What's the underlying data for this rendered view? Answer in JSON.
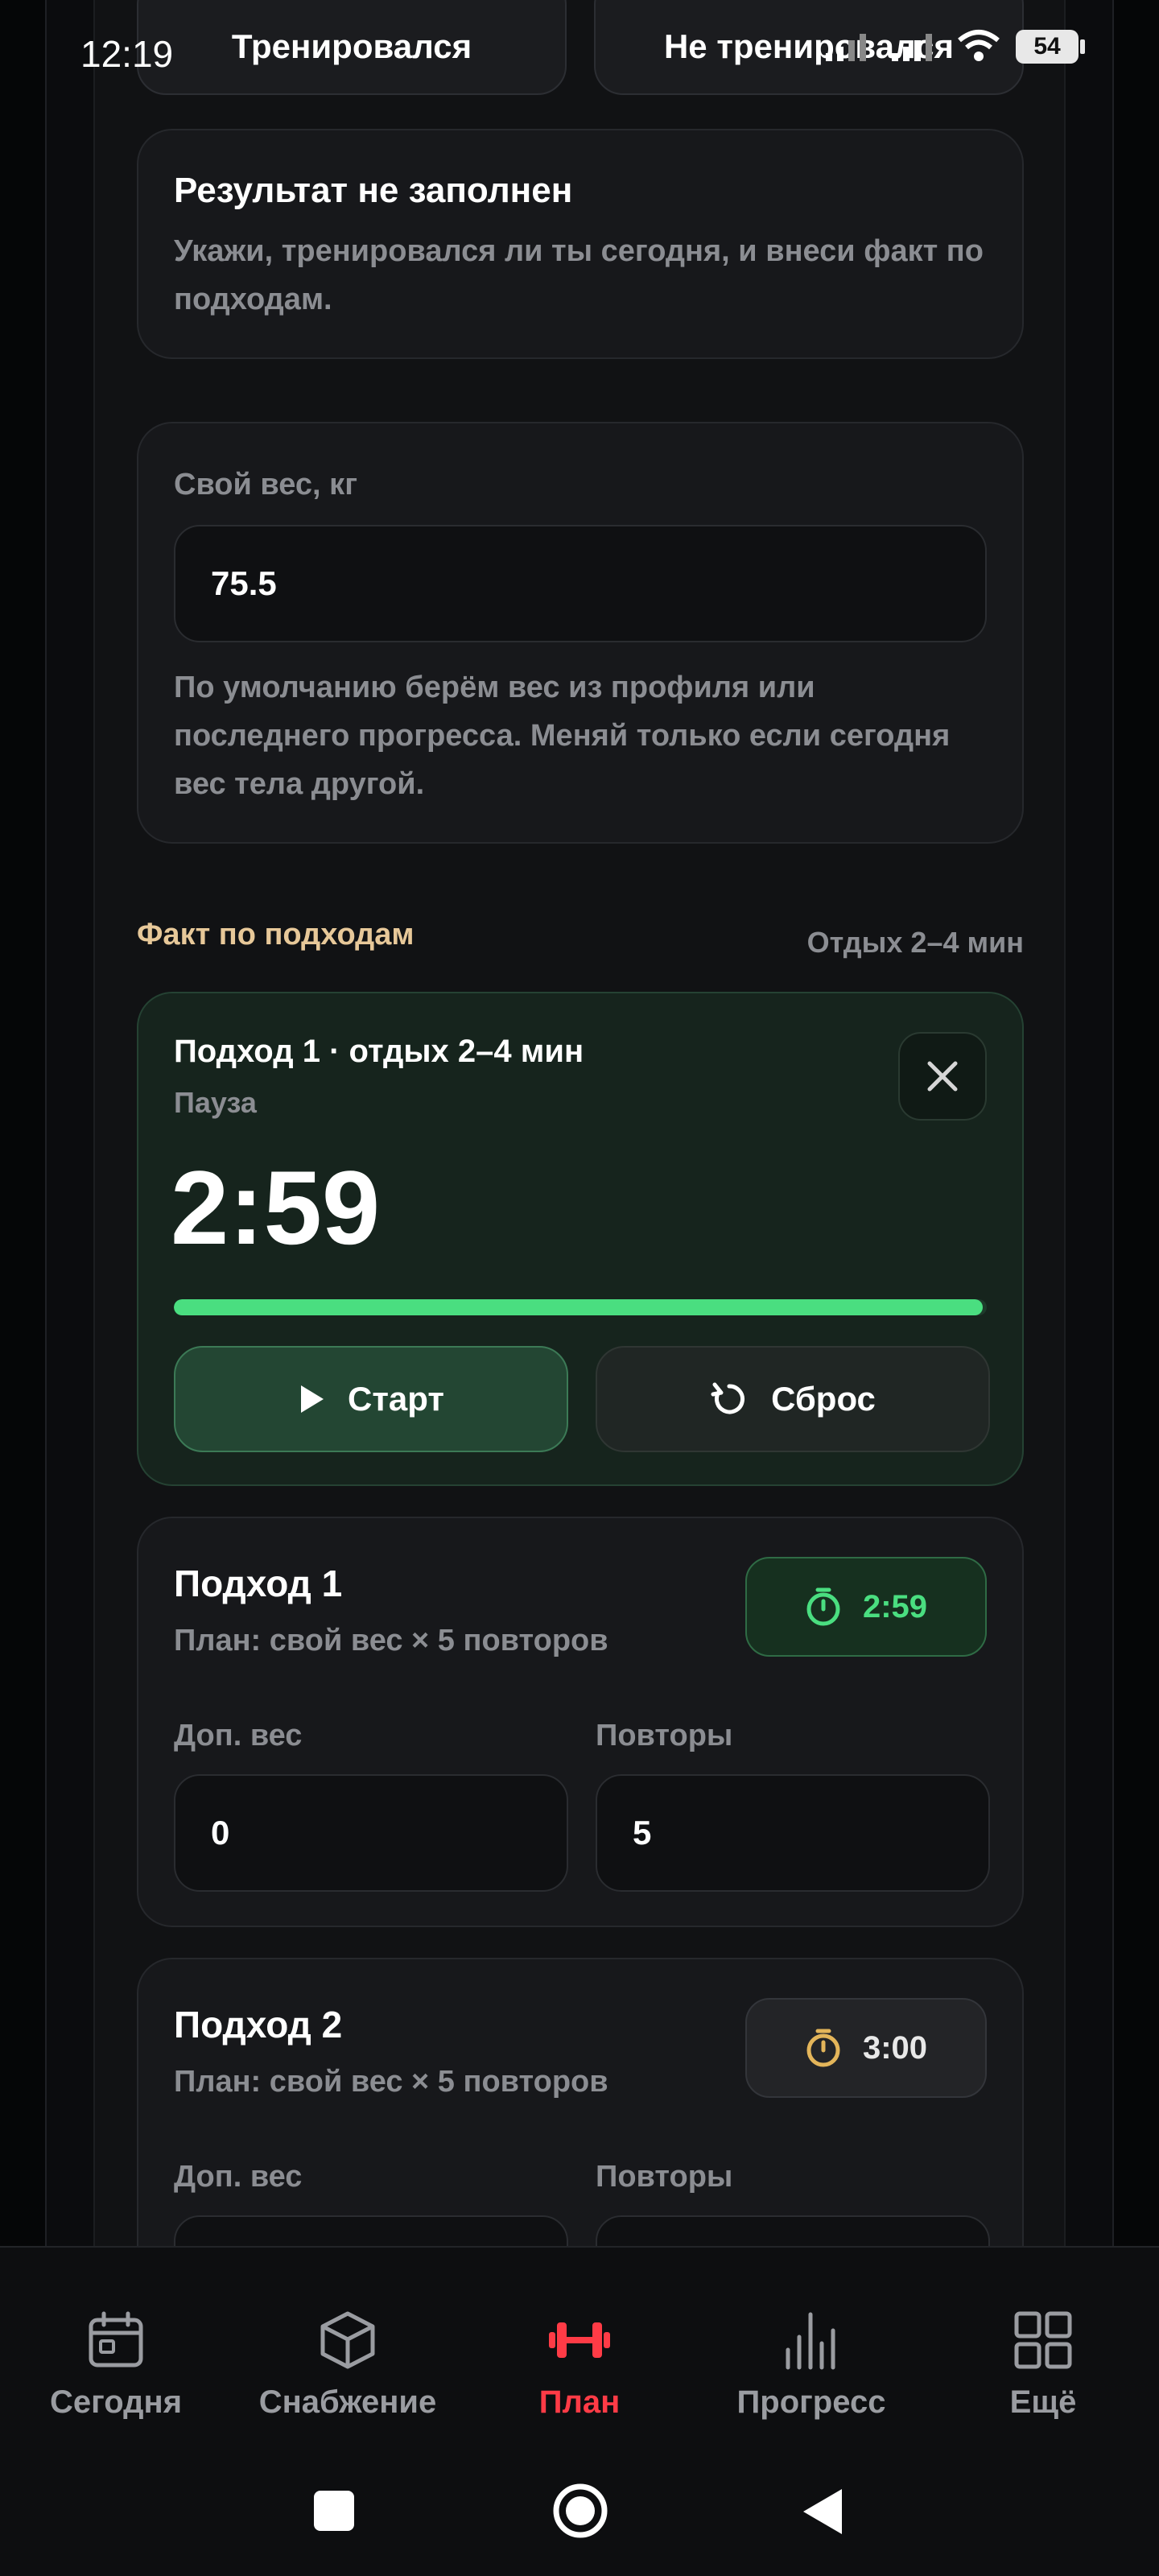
{
  "status_bar": {
    "time": "12:19",
    "battery": "54"
  },
  "toggle": {
    "trained": "Тренировался",
    "not_trained": "Не тренировался"
  },
  "result_card": {
    "title": "Результат не заполнен",
    "text": "Укажи, тренировался ли ты сегодня, и внеси факт по подходам."
  },
  "weight_card": {
    "label": "Свой вес, кг",
    "value": "75.5",
    "hint": "По умолчанию берём вес из профиля или последнего прогресса. Меняй только если сегодня вес тела другой."
  },
  "sets_section": {
    "title": "Факт по подходам",
    "rest": "Отдых 2–4 мин"
  },
  "timer": {
    "title": "Подход 1 · отдых 2–4 мин",
    "state": "Пауза",
    "time": "2:59",
    "progress": 0.995,
    "start_label": "Старт",
    "reset_label": "Сброс"
  },
  "sets": [
    {
      "title": "Подход 1",
      "plan": "План: свой вес × 5 повторов",
      "timer": "2:59",
      "extra_weight_label": "Доп. вес",
      "extra_weight": "0",
      "reps_label": "Повторы",
      "reps": "5"
    },
    {
      "title": "Подход 2",
      "plan": "План: свой вес × 5 повторов",
      "timer": "3:00",
      "extra_weight_label": "Доп. вес",
      "reps_label": "Повторы"
    }
  ],
  "bottom_nav": [
    {
      "label": "Сегодня",
      "icon": "calendar-icon"
    },
    {
      "label": "Снабжение",
      "icon": "box-icon"
    },
    {
      "label": "План",
      "icon": "dumbbell-icon"
    },
    {
      "label": "Прогресс",
      "icon": "bar-chart-icon"
    },
    {
      "label": "Ещё",
      "icon": "grid-icon"
    }
  ],
  "colors": {
    "accent": "#4ade80",
    "nav_active": "#ff3b46",
    "section_title": "#e7c899"
  }
}
